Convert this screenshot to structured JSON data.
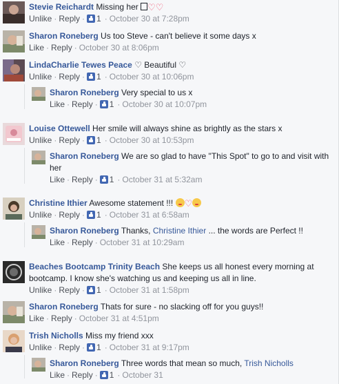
{
  "actions": {
    "like": "Like",
    "unlike": "Unlike",
    "reply": "Reply"
  },
  "comments": [
    {
      "name": "Stevie Reichardt",
      "text": "Missing her",
      "liked": true,
      "count": "1",
      "time": "October 30 at 7:28pm",
      "emoji": [
        "box-icon",
        "heart-icon",
        "heart-icon"
      ]
    },
    {
      "name": "Sharon Roneberg",
      "text": "Us too Steve - can't believe it some days x",
      "liked": false,
      "time": "October 30 at 8:06pm"
    },
    {
      "name": "LindaCharlie Tewes Peace",
      "text": "♡ Beautiful ♡",
      "liked": true,
      "count": "1",
      "time": "October 30 at 10:06pm",
      "replies": [
        {
          "name": "Sharon Roneberg",
          "text": "Very special to us x",
          "liked": false,
          "count": "1",
          "time": "October 30 at 10:07pm"
        }
      ]
    },
    {
      "name": "Louise Ottewell",
      "text": "Her smile will always shine as brightly as the stars x",
      "liked": true,
      "count": "1",
      "time": "October 30 at 10:53pm",
      "replies": [
        {
          "name": "Sharon Roneberg",
          "text": "We are so glad to have \"This Spot\" to go to and visit with her",
          "liked": false,
          "count": "1",
          "time": "October 31 at 5:32am"
        }
      ]
    },
    {
      "name": "Christine Ithier",
      "text": "Awesome statement !!!",
      "liked": true,
      "count": "1",
      "time": "October 31 at 6:58am",
      "emoji": [
        "kiss-face-icon",
        "heart-icon",
        "kiss-face-icon"
      ],
      "replies": [
        {
          "name": "Sharon Roneberg",
          "text_before": "Thanks,",
          "mention": "Christine Ithier",
          "text_after": "... the words are Perfect !!",
          "liked": false,
          "time": "October 31 at 10:29am"
        }
      ]
    },
    {
      "name": "Beaches Bootcamp Trinity Beach",
      "text": "She keeps us all honest every morning at bootcamp. I know she's watching us and keeping us all in line.",
      "liked": true,
      "count": "1",
      "time": "October 31 at 1:58pm"
    },
    {
      "name": "Sharon Roneberg",
      "text": "Thats for sure - no slacking off for you guys!!",
      "liked": false,
      "time": "October 31 at 4:51pm"
    },
    {
      "name": "Trish Nicholls",
      "text": "Miss my friend xxx",
      "liked": true,
      "count": "1",
      "time": "October 31 at 9:17pm",
      "replies": [
        {
          "name": "Sharon Roneberg",
          "text_before": "Three words that mean so much,",
          "mention": "Trish Nicholls",
          "liked": false,
          "count": "1",
          "time": "October 31"
        }
      ]
    }
  ],
  "colors": {
    "link": "#365899",
    "meta": "#90949c",
    "action": "#4b4f56",
    "like": "#4267b2",
    "background": "#f6f7f9"
  }
}
